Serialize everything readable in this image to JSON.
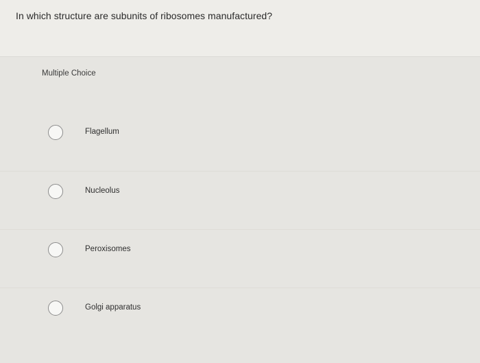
{
  "question": {
    "text": "In which structure are subunits of ribosomes manufactured?"
  },
  "choices": {
    "header": "Multiple Choice",
    "options": [
      {
        "label": "Flagellum",
        "selected": false
      },
      {
        "label": "Nucleolus",
        "selected": false
      },
      {
        "label": "Peroxisomes",
        "selected": false
      },
      {
        "label": "Golgi apparatus",
        "selected": false
      }
    ]
  }
}
